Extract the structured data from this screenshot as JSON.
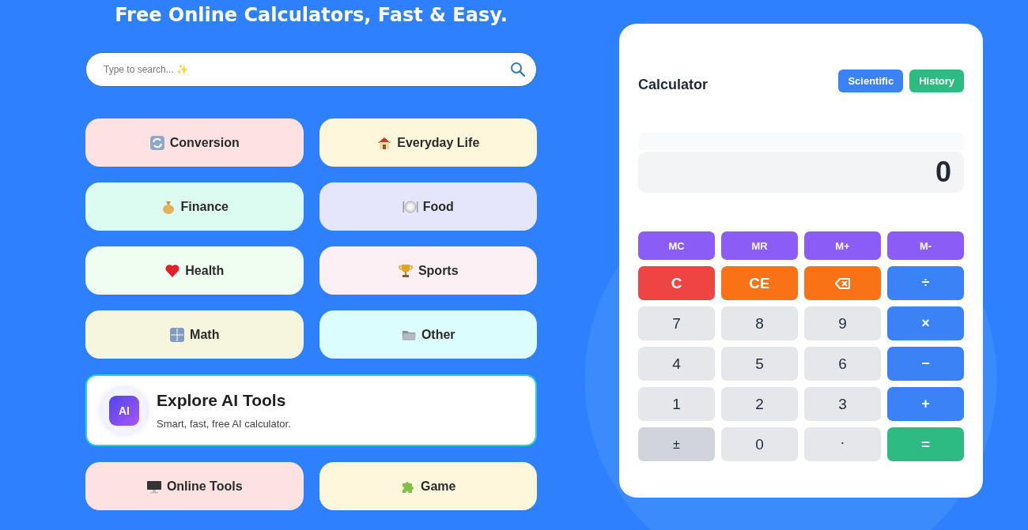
{
  "hero": {
    "title": "Free Online Calculators, Fast & Easy."
  },
  "search": {
    "placeholder": "Type to search... ✨"
  },
  "categories": [
    {
      "label": "Conversion",
      "color": "#fee2e2"
    },
    {
      "label": "Everyday Life",
      "color": "#fef7dc"
    },
    {
      "label": "Finance",
      "color": "#dcfcf2"
    },
    {
      "label": "Food",
      "color": "#e5e6fb"
    },
    {
      "label": "Health",
      "color": "#effef0"
    },
    {
      "label": "Sports",
      "color": "#fdf0f4"
    },
    {
      "label": "Math",
      "color": "#f6f5dd"
    },
    {
      "label": "Other",
      "color": "#dcfdfe"
    }
  ],
  "ai_card": {
    "badge": "AI",
    "title": "Explore AI Tools",
    "subtitle": "Smart, fast, free AI calculator."
  },
  "more_categories": [
    {
      "label": "Online Tools",
      "color": "#fee2e2"
    },
    {
      "label": "Game",
      "color": "#fef7dc"
    }
  ],
  "calculator": {
    "title": "Calculator",
    "modes": [
      "Scientific",
      "History"
    ],
    "display": "0",
    "keys": [
      {
        "kind": "memory",
        "label": "MC"
      },
      {
        "kind": "memory",
        "label": "MR"
      },
      {
        "kind": "memory",
        "label": "M+"
      },
      {
        "kind": "memory",
        "label": "M-"
      },
      {
        "kind": "clear",
        "label": "C"
      },
      {
        "kind": "clear-entry",
        "label": "CE"
      },
      {
        "kind": "backspace"
      },
      {
        "kind": "operator",
        "label": "÷"
      },
      {
        "kind": "digit",
        "label": "7"
      },
      {
        "kind": "digit",
        "label": "8"
      },
      {
        "kind": "digit",
        "label": "9"
      },
      {
        "kind": "operator",
        "label": "×"
      },
      {
        "kind": "digit",
        "label": "4"
      },
      {
        "kind": "digit",
        "label": "5"
      },
      {
        "kind": "digit",
        "label": "6"
      },
      {
        "kind": "operator",
        "label": "−"
      },
      {
        "kind": "digit",
        "label": "1"
      },
      {
        "kind": "digit",
        "label": "2"
      },
      {
        "kind": "digit",
        "label": "3"
      },
      {
        "kind": "operator",
        "label": "+"
      },
      {
        "kind": "sign",
        "label": "±"
      },
      {
        "kind": "digit",
        "label": "0"
      },
      {
        "kind": "decimal",
        "label": "."
      },
      {
        "kind": "equals",
        "label": "="
      }
    ]
  }
}
